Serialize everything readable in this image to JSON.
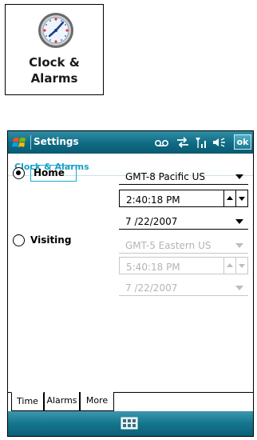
{
  "icon_tile": {
    "label_line1": "Clock &",
    "label_line2": "Alarms",
    "icon": "clock-icon"
  },
  "titlebar": {
    "app_title": "Settings",
    "ok_label": "ok",
    "icons": [
      "windows-start-icon",
      "voicemail-icon",
      "sync-arrows-icon",
      "signal-icon",
      "speaker-icon"
    ]
  },
  "subtitle": "Clock & Alarms",
  "home": {
    "label": "Home",
    "selected": true,
    "timezone": "GMT-8 Pacific US",
    "time": "2:40:18 PM",
    "date": "7 /22/2007"
  },
  "visiting": {
    "label": "Visiting",
    "selected": false,
    "timezone": "GMT-5 Eastern US",
    "time": "5:40:18 PM",
    "date": "7 /22/2007"
  },
  "tabs": [
    {
      "label": "Time",
      "active": true
    },
    {
      "label": "Alarms",
      "active": false
    },
    {
      "label": "More",
      "active": false
    }
  ],
  "menubar": {
    "icon": "keyboard-icon"
  },
  "colors": {
    "accent": "#1a9fc4",
    "titlebar": "#0f6a83",
    "disabled_text": "#b4b4b4"
  }
}
